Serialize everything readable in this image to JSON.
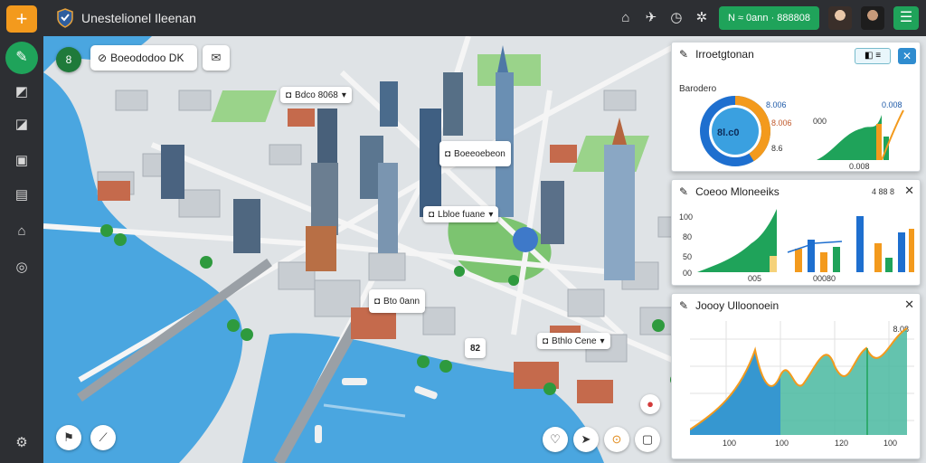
{
  "app": {
    "title": "Unestelionel Ileenan",
    "theme_accent": "#1fa35a",
    "warning": "#f39a1d"
  },
  "topbar": {
    "action_label": "N ≈ 0ann · 888808"
  },
  "map": {
    "search_text": "Boeododoo DK",
    "location_badge": "8",
    "chips": [
      "Bdco 8068",
      "Boeeoebeon",
      "Lbloe fuane",
      "Bto 0ann",
      "Bthlo Cene"
    ],
    "pin_label": "82"
  },
  "panel1": {
    "title": "Irroetgtonan",
    "subtitle": "Barodero",
    "gauge_value": "8l.c0",
    "labels": [
      "8.006",
      "8.006",
      "8.6",
      "0.008",
      "000",
      "0.008"
    ]
  },
  "panel2": {
    "title": "Coeoo Mloneeiks",
    "meta": "4 88 8",
    "ticks": [
      "100",
      "80",
      "50",
      "00"
    ],
    "xlabels": [
      "005",
      "00080"
    ]
  },
  "panel3": {
    "title": "Joooy Ulloonoein",
    "meta": "8.08",
    "xlabels": [
      "100",
      "100",
      "120",
      "100"
    ]
  }
}
